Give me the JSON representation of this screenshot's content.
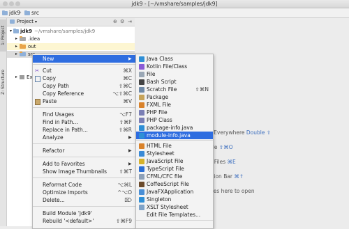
{
  "window": {
    "title": "jdk9 - [~/vmshare/samples/jdk9]"
  },
  "navbar": {
    "crumbs": [
      "jdk9",
      "src"
    ]
  },
  "side_tabs": {
    "project": "1: Project",
    "structure": "Z: Structure"
  },
  "project_panel": {
    "header": "Project",
    "tree": [
      {
        "label": "jdk9",
        "path": "~/vmshare/samples/jdk9"
      },
      {
        "label": ".idea"
      },
      {
        "label": "out"
      },
      {
        "label": "src"
      },
      {
        "label": "Exte"
      }
    ]
  },
  "editor_hints": [
    {
      "text": "rch Everywhere",
      "key": "Double ⇧"
    },
    {
      "text": "o File",
      "key": "⇧⌘O"
    },
    {
      "text": "ent Files",
      "key": "⌘E"
    },
    {
      "text": "igation Bar",
      "key": "⌘↑"
    },
    {
      "text": "o files here to open",
      "key": ""
    }
  ],
  "context_menu": {
    "items": [
      {
        "label": "New",
        "shortcut": "",
        "submenu": true,
        "selected": true,
        "icon": ""
      },
      {
        "label": "Cut",
        "shortcut": "⌘X",
        "icon": "scissors-icon"
      },
      {
        "label": "Copy",
        "shortcut": "⌘C",
        "icon": "copy-icon"
      },
      {
        "label": "Copy Path",
        "shortcut": "⇧⌘C",
        "icon": ""
      },
      {
        "label": "Copy Reference",
        "shortcut": "⌥⇧⌘C",
        "icon": ""
      },
      {
        "label": "Paste",
        "shortcut": "⌘V",
        "icon": "paste-icon"
      },
      {
        "label": "Find Usages",
        "shortcut": "⌥F7",
        "icon": ""
      },
      {
        "label": "Find in Path...",
        "shortcut": "⇧⌘F",
        "icon": ""
      },
      {
        "label": "Replace in Path...",
        "shortcut": "⇧⌘R",
        "icon": ""
      },
      {
        "label": "Analyze",
        "shortcut": "",
        "submenu": true,
        "icon": ""
      },
      {
        "label": "Refactor",
        "shortcut": "",
        "submenu": true,
        "icon": ""
      },
      {
        "label": "Add to Favorites",
        "shortcut": "",
        "submenu": true,
        "icon": ""
      },
      {
        "label": "Show Image Thumbnails",
        "shortcut": "⇧⌘T",
        "icon": ""
      },
      {
        "label": "Reformat Code",
        "shortcut": "⌥⌘L",
        "icon": ""
      },
      {
        "label": "Optimize Imports",
        "shortcut": "^⌥O",
        "icon": ""
      },
      {
        "label": "Delete...",
        "shortcut": "⌦",
        "icon": ""
      },
      {
        "label": "Build Module 'jdk9'",
        "shortcut": "",
        "icon": ""
      },
      {
        "label": "Rebuild '<default>'",
        "shortcut": "⇧⌘F9",
        "icon": ""
      }
    ]
  },
  "new_submenu": {
    "items": [
      {
        "label": "Java Class",
        "shortcut": "",
        "icon": "java-class-icon",
        "color": "#2f8fd6"
      },
      {
        "label": "Kotlin File/Class",
        "shortcut": "",
        "icon": "kotlin-icon",
        "color": "#8a5bd6"
      },
      {
        "label": "File",
        "shortcut": "",
        "icon": "file-icon",
        "color": "#9aa7b5"
      },
      {
        "label": "Bash Script",
        "shortcut": "",
        "icon": "bash-icon",
        "color": "#444444"
      },
      {
        "label": "Scratch File",
        "shortcut": "⇧⌘N",
        "icon": "scratch-file-icon",
        "color": "#6f8aa8"
      },
      {
        "label": "Package",
        "shortcut": "",
        "icon": "package-icon",
        "color": "#c7a45a"
      },
      {
        "label": "FXML File",
        "shortcut": "",
        "icon": "fxml-icon",
        "color": "#d9822b"
      },
      {
        "label": "PHP File",
        "shortcut": "",
        "icon": "php-icon",
        "color": "#7b7fb5"
      },
      {
        "label": "PHP Class",
        "shortcut": "",
        "icon": "php-class-icon",
        "color": "#7b7fb5"
      },
      {
        "label": "package-info.java",
        "shortcut": "",
        "icon": "java-file-icon",
        "color": "#2f8fd6"
      },
      {
        "label": "module-info.java",
        "shortcut": "",
        "icon": "java-file-icon",
        "color": "#2f8fd6",
        "selected": true
      },
      {
        "label": "HTML File",
        "shortcut": "",
        "icon": "html-icon",
        "color": "#d9822b"
      },
      {
        "label": "Stylesheet",
        "shortcut": "",
        "icon": "css-icon",
        "color": "#3a8ad6"
      },
      {
        "label": "JavaScript File",
        "shortcut": "",
        "icon": "javascript-icon",
        "color": "#d6b22b"
      },
      {
        "label": "TypeScript File",
        "shortcut": "",
        "icon": "typescript-icon",
        "color": "#2b6fd6"
      },
      {
        "label": "CFML/CFC file",
        "shortcut": "",
        "icon": "cfml-icon",
        "color": "#8da0b8"
      },
      {
        "label": "CoffeeScript File",
        "shortcut": "",
        "icon": "coffeescript-icon",
        "color": "#6b4a2b"
      },
      {
        "label": "JavaFXApplication",
        "shortcut": "",
        "icon": "javafx-icon",
        "color": "#4a8fd6"
      },
      {
        "label": "Singleton",
        "shortcut": "",
        "icon": "singleton-icon",
        "color": "#2f8fd6"
      },
      {
        "label": "XSLT Stylesheet",
        "shortcut": "",
        "icon": "xslt-icon",
        "color": "#7fa3c8"
      },
      {
        "label": "Edit File Templates...",
        "shortcut": "",
        "icon": "",
        "color": ""
      }
    ]
  }
}
